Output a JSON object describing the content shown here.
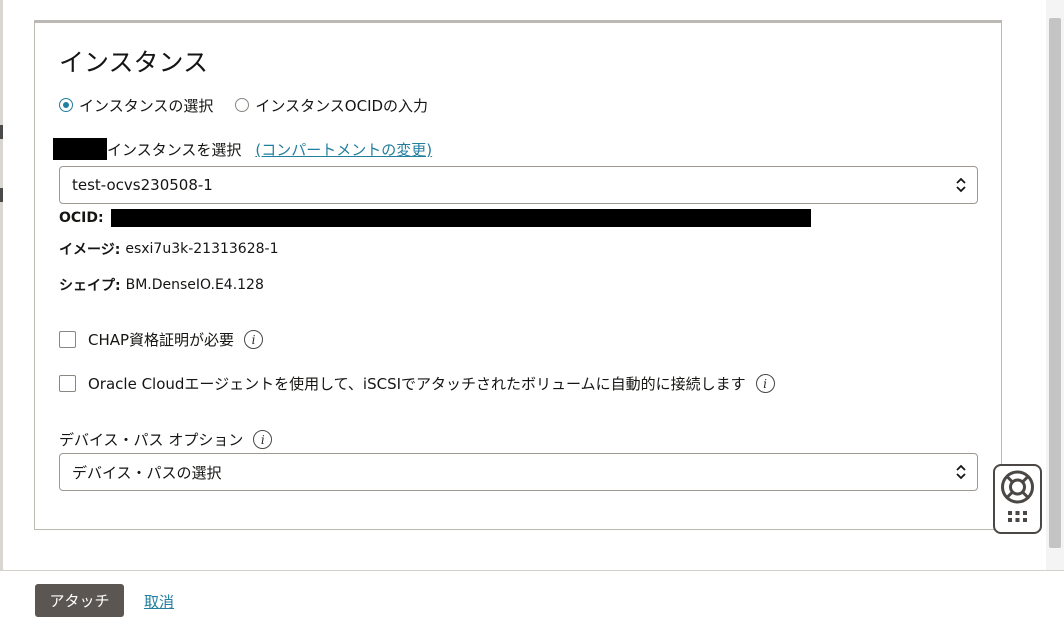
{
  "panel": {
    "title": "インスタンス",
    "radio_select_instance": "インスタンスの選択",
    "radio_enter_ocid": "インスタンスOCIDの入力",
    "select_instance_label": "インスタンスを選択",
    "change_compartment_link": "(コンパートメントの変更)",
    "instance_select_value": "test-ocvs230508-1",
    "ocid_key": "OCID:",
    "image_key": "イメージ:",
    "image_value": "esxi7u3k-21313628-1",
    "shape_key": "シェイプ:",
    "shape_value": "BM.DenseIO.E4.128",
    "chap_label": "CHAP資格証明が必要",
    "oracle_agent_label": "Oracle Cloudエージェントを使用して、iSCSIでアタッチされたボリュームに自動的に接続します",
    "device_path_label": "デバイス・パス オプション",
    "device_path_placeholder": "デバイス・パスの選択"
  },
  "state": {
    "selected_radio": "select_instance",
    "chap_checked": false,
    "oracle_agent_checked": false
  },
  "footer": {
    "attach_button": "アタッチ",
    "cancel_link": "取消"
  },
  "colors": {
    "accent": "#227e9e",
    "primary_button": "#5b5652"
  },
  "icons": {
    "info": "info-icon",
    "select_chevrons": "up-down-chevron-icon",
    "help": "lifebuoy-icon",
    "apps": "grid-dots-icon"
  }
}
